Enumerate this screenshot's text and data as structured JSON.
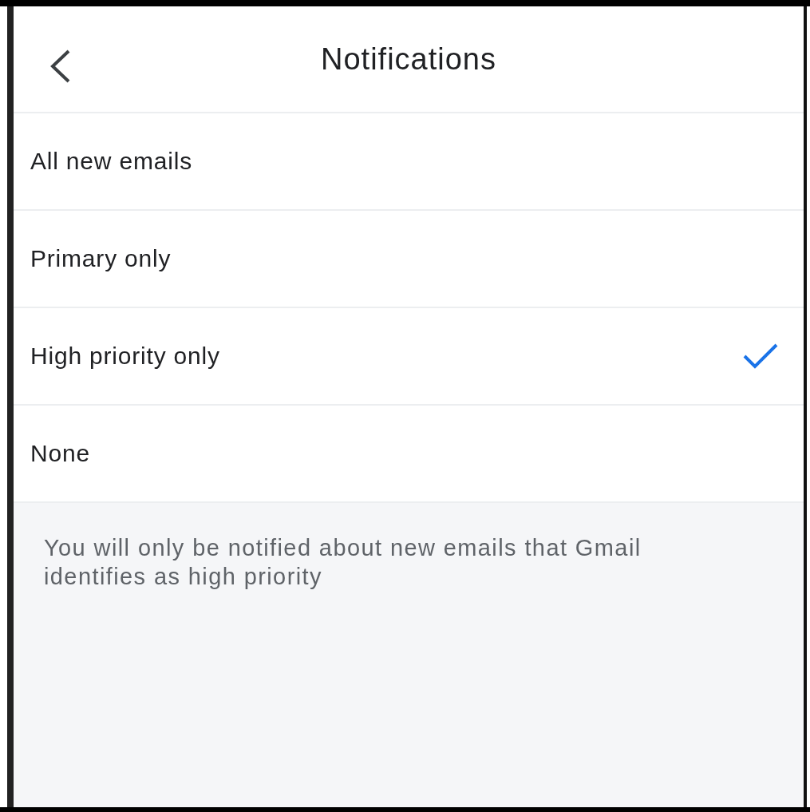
{
  "header": {
    "title": "Notifications"
  },
  "options": [
    {
      "label": "All new emails",
      "selected": false
    },
    {
      "label": "Primary only",
      "selected": false
    },
    {
      "label": "High priority only",
      "selected": true
    },
    {
      "label": "None",
      "selected": false
    }
  ],
  "footer_note": "You will only be notified about new emails that Gmail identifies as high priority"
}
